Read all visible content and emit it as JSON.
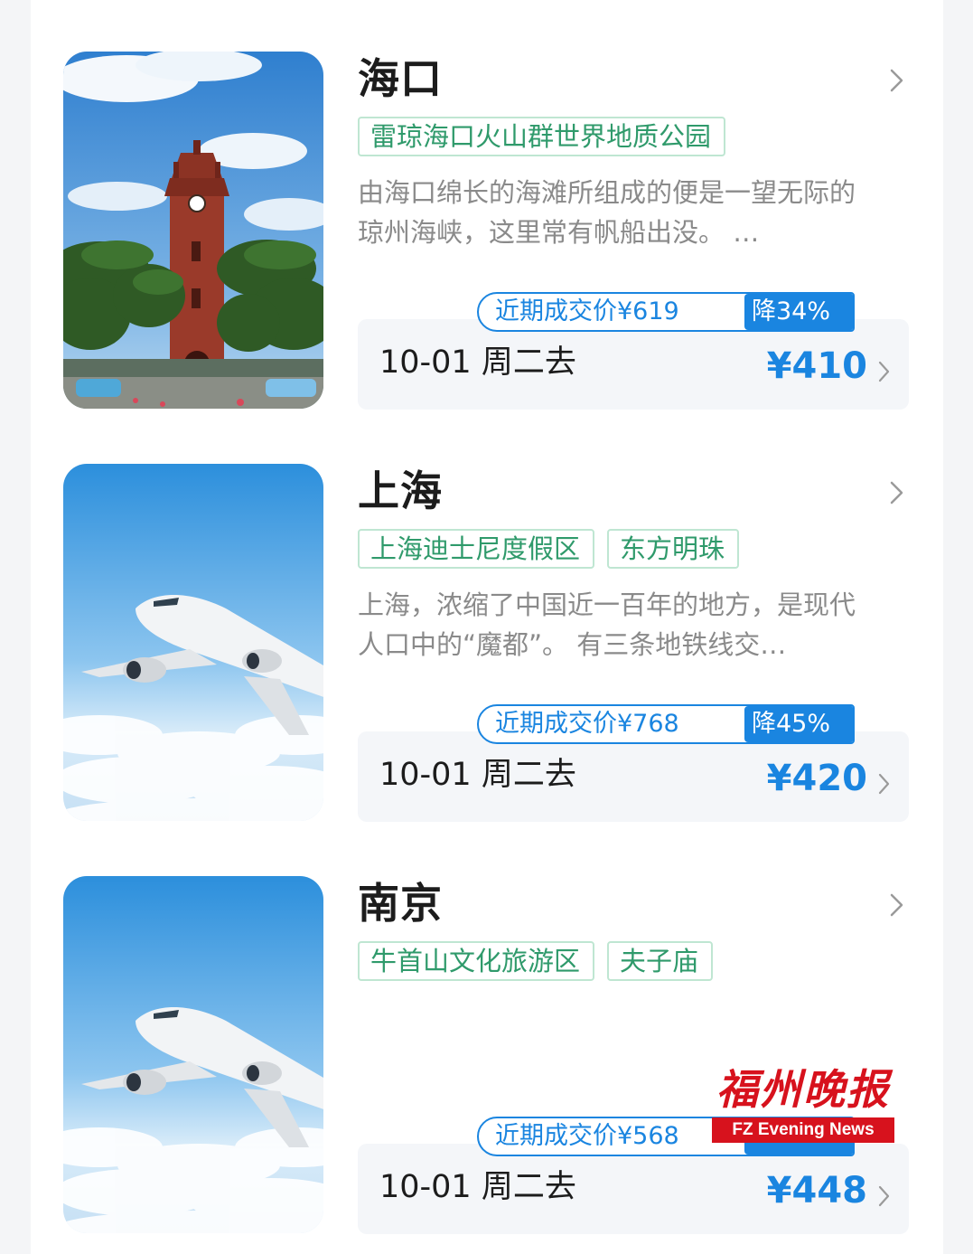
{
  "colors": {
    "accent": "#1a85e0",
    "tag_text": "#2f9a6b",
    "tag_border": "#bfe6d2",
    "watermark_red": "#d7121d"
  },
  "cards": [
    {
      "city": "海口",
      "tags": [
        "雷琼海口火山群世界地质公园"
      ],
      "description": "由海口绵长的海滩所组成的便是一望无际的琼州海峡，这里常有帆船出没。 …",
      "recent_label": "近期成交价¥619",
      "drop_label": "降34%",
      "date_label": "10-01 周二去",
      "price": "¥410",
      "image": "clock-tower-photo"
    },
    {
      "city": "上海",
      "tags": [
        "上海迪士尼度假区",
        "东方明珠"
      ],
      "description": "上海，浓缩了中国近一百年的地方，是现代人口中的“魔都”。 有三条地铁线交…",
      "recent_label": "近期成交价¥768",
      "drop_label": "降45%",
      "date_label": "10-01 周二去",
      "price": "¥420",
      "image": "airplane-photo"
    },
    {
      "city": "南京",
      "tags": [
        "牛首山文化旅游区",
        "夫子庙"
      ],
      "description": "",
      "recent_label": "近期成交价¥568",
      "drop_label": "",
      "date_label": "10-01 周二去",
      "price": "¥448",
      "image": "airplane-photo"
    }
  ],
  "watermark": {
    "chinese": "福州晚报",
    "english": "FZ Evening News"
  }
}
